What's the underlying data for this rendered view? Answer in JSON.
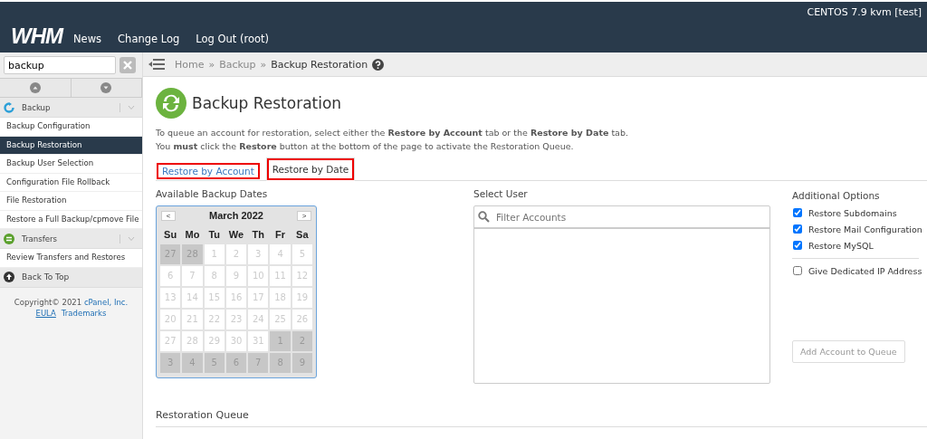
{
  "header": {
    "brand": "WHM",
    "nav": [
      "News",
      "Change Log",
      "Log Out (root)"
    ],
    "server": "CENTOS 7.9 kvm [test]"
  },
  "sidebar": {
    "search": {
      "value": "backup"
    },
    "groups": [
      {
        "title": "Backup",
        "items": [
          {
            "label": "Backup Configuration",
            "selected": false
          },
          {
            "label": "Backup Restoration",
            "selected": true
          },
          {
            "label": "Backup User Selection",
            "selected": false
          },
          {
            "label": "Configuration File Rollback",
            "selected": false
          },
          {
            "label": "File Restoration",
            "selected": false
          },
          {
            "label": "Restore a Full Backup/cpmove File",
            "selected": false
          }
        ]
      },
      {
        "title": "Transfers",
        "items": [
          {
            "label": "Review Transfers and Restores",
            "selected": false
          }
        ]
      }
    ],
    "back_to_top": "Back To Top",
    "footer": {
      "copyright": "Copyright© 2021",
      "company": "cPanel, Inc.",
      "links": [
        "EULA",
        "Trademarks"
      ]
    }
  },
  "breadcrumb": [
    "Home",
    "Backup",
    "Backup Restoration"
  ],
  "breadcrumb_separators": [
    "»",
    "»"
  ],
  "page": {
    "title": "Backup Restoration",
    "intro": [
      "To queue an account for restoration, select either the **Restore by Account** tab or the **Restore by Date** tab.",
      "You **must** click the **Restore** button at the bottom of the page to activate the Restoration Queue."
    ],
    "tabs": [
      {
        "label": "Restore by Account",
        "selected": false,
        "highlighted": true
      },
      {
        "label": "Restore by Date",
        "selected": true,
        "highlighted": true
      }
    ],
    "dates_label": "Available Backup Dates",
    "calendar": {
      "month": "March 2022",
      "prev": "<",
      "next": ">",
      "weekdays": [
        "Su",
        "Mo",
        "Tu",
        "We",
        "Th",
        "Fr",
        "Sa"
      ],
      "weeks": [
        [
          {
            "day": "27",
            "outside": true
          },
          {
            "day": "28",
            "outside": true
          },
          {
            "day": "1",
            "outside": false
          },
          {
            "day": "2",
            "outside": false
          },
          {
            "day": "3",
            "outside": false
          },
          {
            "day": "4",
            "outside": false
          },
          {
            "day": "5",
            "outside": false
          }
        ],
        [
          {
            "day": "6",
            "outside": false
          },
          {
            "day": "7",
            "outside": false
          },
          {
            "day": "8",
            "outside": false
          },
          {
            "day": "9",
            "outside": false
          },
          {
            "day": "10",
            "outside": false
          },
          {
            "day": "11",
            "outside": false
          },
          {
            "day": "12",
            "outside": false
          }
        ],
        [
          {
            "day": "13",
            "outside": false
          },
          {
            "day": "14",
            "outside": false
          },
          {
            "day": "15",
            "outside": false
          },
          {
            "day": "16",
            "outside": false
          },
          {
            "day": "17",
            "outside": false
          },
          {
            "day": "18",
            "outside": false
          },
          {
            "day": "19",
            "outside": false
          }
        ],
        [
          {
            "day": "20",
            "outside": false
          },
          {
            "day": "21",
            "outside": false
          },
          {
            "day": "22",
            "outside": false
          },
          {
            "day": "23",
            "outside": false
          },
          {
            "day": "24",
            "outside": false
          },
          {
            "day": "25",
            "outside": false
          },
          {
            "day": "26",
            "outside": false
          }
        ],
        [
          {
            "day": "27",
            "outside": false
          },
          {
            "day": "28",
            "outside": false
          },
          {
            "day": "29",
            "outside": false
          },
          {
            "day": "30",
            "outside": false
          },
          {
            "day": "31",
            "outside": false
          },
          {
            "day": "1",
            "outside": true
          },
          {
            "day": "2",
            "outside": true
          }
        ],
        [
          {
            "day": "3",
            "outside": true
          },
          {
            "day": "4",
            "outside": true
          },
          {
            "day": "5",
            "outside": true
          },
          {
            "day": "6",
            "outside": true
          },
          {
            "day": "7",
            "outside": true
          },
          {
            "day": "8",
            "outside": true
          },
          {
            "day": "9",
            "outside": true
          }
        ]
      ]
    },
    "user_label": "Select User",
    "filter": {
      "placeholder": "Filter Accounts"
    },
    "options_label": "Additional Options",
    "options": [
      {
        "label": "Restore Subdomains",
        "checked": true
      },
      {
        "label": "Restore Mail Configuration",
        "checked": true
      },
      {
        "label": "Restore MySQL",
        "checked": true
      }
    ],
    "dedicated_ip": {
      "label": "Give Dedicated IP Address",
      "checked": false
    },
    "add_button": "Add Account to Queue",
    "queue_title": "Restoration Queue"
  }
}
